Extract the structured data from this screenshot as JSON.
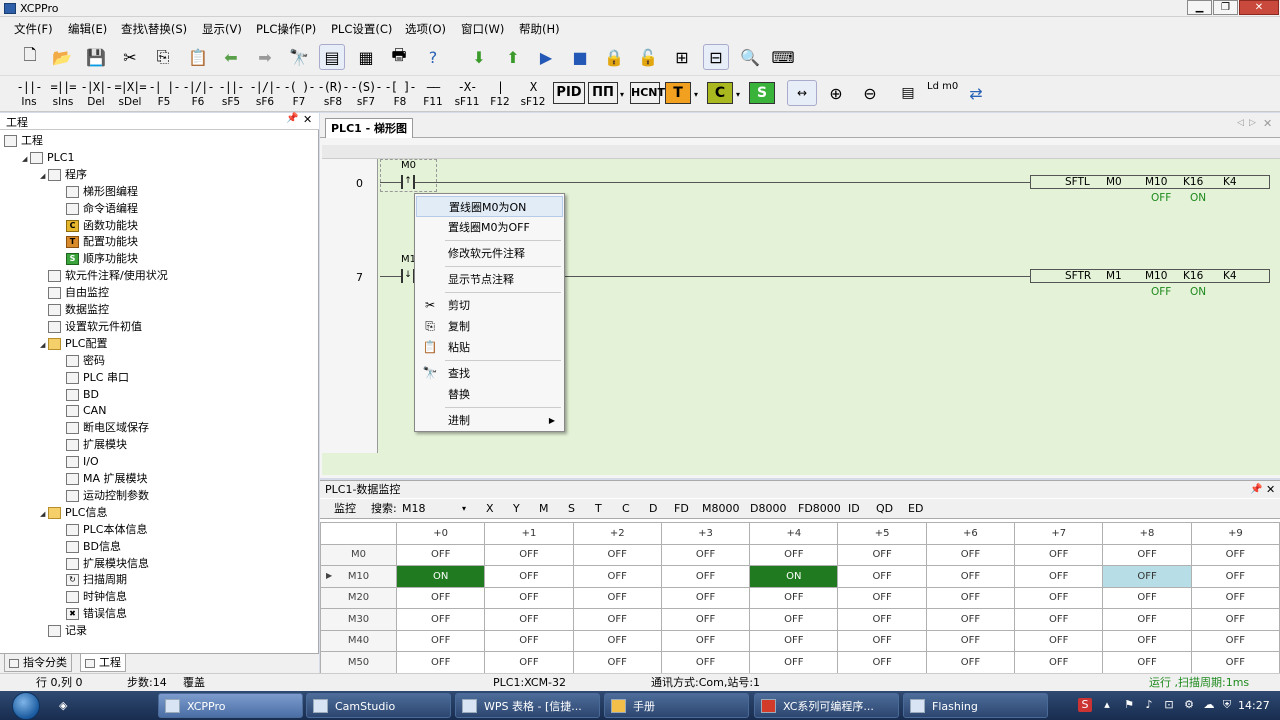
{
  "window": {
    "title": "XCPPro"
  },
  "menu": [
    "文件(F)",
    "编辑(E)",
    "查找\\替换(S)",
    "显示(V)",
    "PLC操作(P)",
    "PLC设置(C)",
    "选项(O)",
    "窗口(W)",
    "帮助(H)"
  ],
  "ladder_toolbar": [
    {
      "sym": "-||-",
      "label": "Ins"
    },
    {
      "sym": "=||=",
      "label": "sIns"
    },
    {
      "sym": "-|X|-",
      "label": "Del"
    },
    {
      "sym": "=|X|=",
      "label": "sDel"
    },
    {
      "sym": "-| |-",
      "label": "F5"
    },
    {
      "sym": "-|/|-",
      "label": "F6"
    },
    {
      "sym": "-||-",
      "label": "sF5"
    },
    {
      "sym": "-|/|-",
      "label": "sF6"
    },
    {
      "sym": "-( )-",
      "label": "F7"
    },
    {
      "sym": "-(R)-",
      "label": "sF8"
    },
    {
      "sym": "-(S)-",
      "label": "sF7"
    },
    {
      "sym": "-[ ]-",
      "label": "F8"
    },
    {
      "sym": "——",
      "label": "F11"
    },
    {
      "sym": "-X-",
      "label": "sF11"
    },
    {
      "sym": "|",
      "label": "F12"
    },
    {
      "sym": "X",
      "label": "sF12"
    }
  ],
  "ladder_buttons": {
    "pid": "PID",
    "pulse": "ΠΠ",
    "hcnt": "HCNT",
    "t": "T",
    "c": "C",
    "s": "S",
    "ldm0": "Ld m0"
  },
  "left_panel": {
    "title": "工程",
    "tree": [
      {
        "label": "工程",
        "level": 0,
        "icon": "project-icon"
      },
      {
        "label": "PLC1",
        "level": 1,
        "icon": "plc-icon"
      },
      {
        "label": "程序",
        "level": 2,
        "icon": "program-icon"
      },
      {
        "label": "梯形图编程",
        "level": 3,
        "icon": "ladder-icon"
      },
      {
        "label": "命令语编程",
        "level": 3,
        "icon": "instruction-icon"
      },
      {
        "label": "函数功能块",
        "level": 3,
        "icon": "function-block-icon"
      },
      {
        "label": "配置功能块",
        "level": 3,
        "icon": "config-block-icon"
      },
      {
        "label": "顺序功能块",
        "level": 3,
        "icon": "sequence-block-icon"
      },
      {
        "label": "软元件注释/使用状况",
        "level": 2,
        "icon": "comment-icon"
      },
      {
        "label": "自由监控",
        "level": 2,
        "icon": "free-monitor-icon"
      },
      {
        "label": "数据监控",
        "level": 2,
        "icon": "data-monitor-icon"
      },
      {
        "label": "设置软元件初值",
        "level": 2,
        "icon": "init-value-icon"
      },
      {
        "label": "PLC配置",
        "level": 2,
        "icon": "folder-icon"
      },
      {
        "label": "密码",
        "level": 3,
        "icon": "password-icon"
      },
      {
        "label": "PLC 串口",
        "level": 3,
        "icon": "serial-port-icon"
      },
      {
        "label": "BD",
        "level": 3,
        "icon": "bd-icon"
      },
      {
        "label": "CAN",
        "level": 3,
        "icon": "can-icon"
      },
      {
        "label": "断电区域保存",
        "level": 3,
        "icon": "power-save-icon"
      },
      {
        "label": "扩展模块",
        "level": 3,
        "icon": "expansion-icon"
      },
      {
        "label": "I/O",
        "level": 3,
        "icon": "io-icon"
      },
      {
        "label": "MA 扩展模块",
        "level": 3,
        "icon": "ma-module-icon"
      },
      {
        "label": "运动控制参数",
        "level": 3,
        "icon": "motion-icon"
      },
      {
        "label": "PLC信息",
        "level": 2,
        "icon": "folder-icon"
      },
      {
        "label": "PLC本体信息",
        "level": 3,
        "icon": "plc-info-icon"
      },
      {
        "label": "BD信息",
        "level": 3,
        "icon": "bd-info-icon"
      },
      {
        "label": "扩展模块信息",
        "level": 3,
        "icon": "expansion-info-icon"
      },
      {
        "label": "扫描周期",
        "level": 3,
        "icon": "scan-cycle-icon"
      },
      {
        "label": "时钟信息",
        "level": 3,
        "icon": "clock-info-icon"
      },
      {
        "label": "错误信息",
        "level": 3,
        "icon": "error-info-icon"
      },
      {
        "label": "记录",
        "level": 2,
        "icon": "record-icon"
      }
    ],
    "tabs": [
      "指令分类",
      "工程"
    ]
  },
  "ladder": {
    "tab": "PLC1 - 梯形图",
    "rungs": [
      {
        "step": "0",
        "contact": "M0",
        "instr": "SFTL",
        "ops": [
          "M0",
          "M10",
          "K16",
          "K4"
        ],
        "states": [
          "OFF",
          "ON"
        ]
      },
      {
        "step": "7",
        "contact": "M1",
        "instr": "SFTR",
        "ops": [
          "M1",
          "M10",
          "K16",
          "K4"
        ],
        "states": [
          "OFF",
          "ON"
        ]
      }
    ]
  },
  "context_menu": [
    {
      "label": "置线圈M0为ON",
      "icon": ""
    },
    {
      "label": "置线圈M0为OFF",
      "icon": ""
    },
    {
      "sep": true
    },
    {
      "label": "修改软元件注释",
      "icon": ""
    },
    {
      "sep": true
    },
    {
      "label": "显示节点注释",
      "icon": ""
    },
    {
      "sep": true
    },
    {
      "label": "剪切",
      "icon": "cut-icon"
    },
    {
      "label": "复制",
      "icon": "copy-icon"
    },
    {
      "label": "粘贴",
      "icon": "paste-icon"
    },
    {
      "sep": true
    },
    {
      "label": "查找",
      "icon": "find-icon"
    },
    {
      "label": "替换",
      "icon": ""
    },
    {
      "sep": true
    },
    {
      "label": "进制",
      "icon": "",
      "submenu": true
    }
  ],
  "monitor": {
    "title": "PLC1-数据监控",
    "toolbar": [
      "监控",
      "搜索:",
      "M18",
      "X",
      "Y",
      "M",
      "S",
      "T",
      "C",
      "D",
      "FD",
      "M8000",
      "D8000",
      "FD8000",
      "ID",
      "QD",
      "ED"
    ],
    "columns": [
      "+0",
      "+1",
      "+2",
      "+3",
      "+4",
      "+5",
      "+6",
      "+7",
      "+8",
      "+9"
    ],
    "rows": [
      {
        "name": "M0",
        "values": [
          "OFF",
          "OFF",
          "OFF",
          "OFF",
          "OFF",
          "OFF",
          "OFF",
          "OFF",
          "OFF",
          "OFF"
        ]
      },
      {
        "name": "M10",
        "values": [
          "ON",
          "OFF",
          "OFF",
          "OFF",
          "ON",
          "OFF",
          "OFF",
          "OFF",
          "OFF",
          "OFF"
        ]
      },
      {
        "name": "M20",
        "values": [
          "OFF",
          "OFF",
          "OFF",
          "OFF",
          "OFF",
          "OFF",
          "OFF",
          "OFF",
          "OFF",
          "OFF"
        ]
      },
      {
        "name": "M30",
        "values": [
          "OFF",
          "OFF",
          "OFF",
          "OFF",
          "OFF",
          "OFF",
          "OFF",
          "OFF",
          "OFF",
          "OFF"
        ]
      },
      {
        "name": "M40",
        "values": [
          "OFF",
          "OFF",
          "OFF",
          "OFF",
          "OFF",
          "OFF",
          "OFF",
          "OFF",
          "OFF",
          "OFF"
        ]
      },
      {
        "name": "M50",
        "values": [
          "OFF",
          "OFF",
          "OFF",
          "OFF",
          "OFF",
          "OFF",
          "OFF",
          "OFF",
          "OFF",
          "OFF"
        ]
      }
    ]
  },
  "status": {
    "pos": "行 0,列 0",
    "steps": "步数:14",
    "mode": "覆盖",
    "plc": "PLC1:XCM-32",
    "comm": "通讯方式:Com,站号:1",
    "run": "运行 ,扫描周期:1ms"
  },
  "taskbar": {
    "items": [
      "XCPPro",
      "CamStudio",
      "WPS 表格 - [信捷...",
      "手册",
      "XC系列可编程序...",
      "Flashing"
    ],
    "clock": "14:27"
  },
  "colors": {
    "on": "#207a20",
    "status_on": "#1e8a1e",
    "ladder_bg": "#e4f2d7",
    "coil_border": "#555555"
  }
}
